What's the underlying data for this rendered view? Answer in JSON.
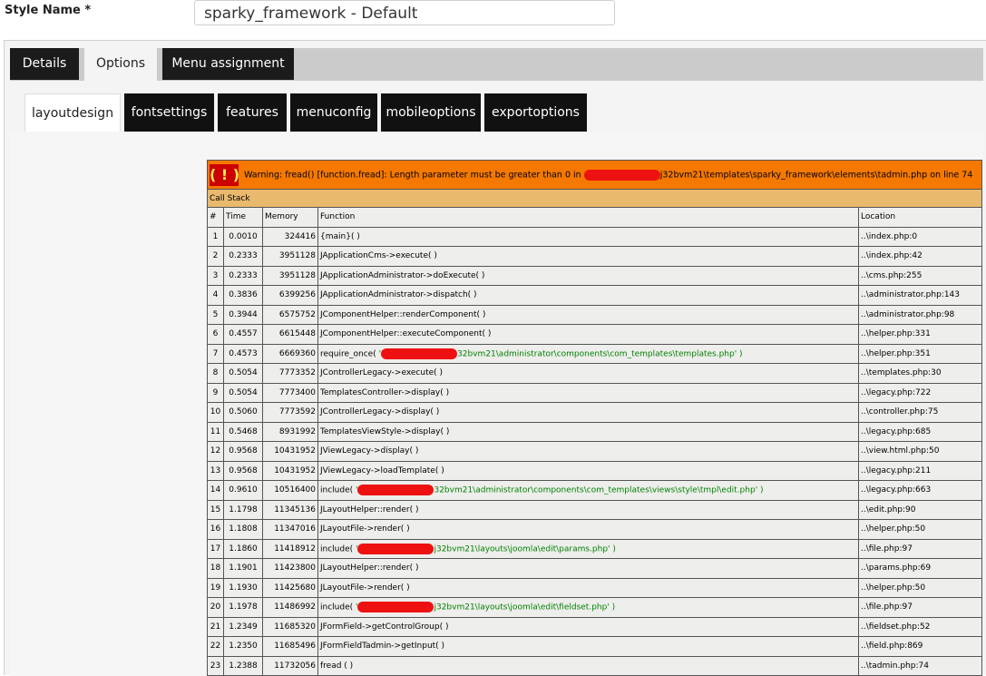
{
  "style_name": {
    "label": "Style Name *",
    "value": "sparky_framework - Default"
  },
  "tabs": [
    {
      "label": "Details",
      "active": false
    },
    {
      "label": "Options",
      "active": true
    },
    {
      "label": "Menu assignment",
      "active": false
    }
  ],
  "subtabs": [
    {
      "label": "layoutdesign",
      "active": true
    },
    {
      "label": "fontsettings",
      "active": false
    },
    {
      "label": "features",
      "active": false
    },
    {
      "label": "menuconfig",
      "active": false
    },
    {
      "label": "mobileoptions",
      "active": false
    },
    {
      "label": "exportoptions",
      "active": false
    }
  ],
  "warning": {
    "icon_text": "( ! )",
    "prefix": "Warning: fread() [function.fread]: Length parameter must be greater than 0 in",
    "suffix": "j32bvm21\\templates\\sparky_framework\\elements\\tadmin.php on line 74"
  },
  "call_stack_title": "Call Stack",
  "columns": [
    "#",
    "Time",
    "Memory",
    "Function",
    "Location"
  ],
  "rows": [
    {
      "n": "1",
      "time": "0.0010",
      "mem": "324416",
      "fn": "{main}( )",
      "param": "",
      "loc": "..\\index.php:0"
    },
    {
      "n": "2",
      "time": "0.2333",
      "mem": "3951128",
      "fn": "JApplicationCms->execute( )",
      "param": "",
      "loc": "..\\index.php:42"
    },
    {
      "n": "3",
      "time": "0.2333",
      "mem": "3951128",
      "fn": "JApplicationAdministrator->doExecute( )",
      "param": "",
      "loc": "..\\cms.php:255"
    },
    {
      "n": "4",
      "time": "0.3836",
      "mem": "6399256",
      "fn": "JApplicationAdministrator->dispatch( )",
      "param": "",
      "loc": "..\\administrator.php:143"
    },
    {
      "n": "5",
      "time": "0.3944",
      "mem": "6575752",
      "fn": "JComponentHelper::renderComponent( )",
      "param": "",
      "loc": "..\\administrator.php:98"
    },
    {
      "n": "6",
      "time": "0.4557",
      "mem": "6615448",
      "fn": "JComponentHelper::executeComponent( )",
      "param": "",
      "loc": "..\\helper.php:331"
    },
    {
      "n": "7",
      "time": "0.4573",
      "mem": "6669360",
      "fn": "require_once(",
      "param": "32bvm21\\administrator\\components\\com_templates\\templates.php' )",
      "loc": "..\\helper.php:351"
    },
    {
      "n": "8",
      "time": "0.5054",
      "mem": "7773352",
      "fn": "JControllerLegacy->execute( )",
      "param": "",
      "loc": "..\\templates.php:30"
    },
    {
      "n": "9",
      "time": "0.5054",
      "mem": "7773400",
      "fn": "TemplatesController->display( )",
      "param": "",
      "loc": "..\\legacy.php:722"
    },
    {
      "n": "10",
      "time": "0.5060",
      "mem": "7773592",
      "fn": "JControllerLegacy->display( )",
      "param": "",
      "loc": "..\\controller.php:75"
    },
    {
      "n": "11",
      "time": "0.5468",
      "mem": "8931992",
      "fn": "TemplatesViewStyle->display( )",
      "param": "",
      "loc": "..\\legacy.php:685"
    },
    {
      "n": "12",
      "time": "0.9568",
      "mem": "10431952",
      "fn": "JViewLegacy->display( )",
      "param": "",
      "loc": "..\\view.html.php:50"
    },
    {
      "n": "13",
      "time": "0.9568",
      "mem": "10431952",
      "fn": "JViewLegacy->loadTemplate( )",
      "param": "",
      "loc": "..\\legacy.php:211"
    },
    {
      "n": "14",
      "time": "0.9610",
      "mem": "10516400",
      "fn": "include(",
      "param": "32bvm21\\administrator\\components\\com_templates\\views\\style\\tmpl\\edit.php' )",
      "loc": "..\\legacy.php:663"
    },
    {
      "n": "15",
      "time": "1.1798",
      "mem": "11345136",
      "fn": "JLayoutHelper::render( )",
      "param": "",
      "loc": "..\\edit.php:90"
    },
    {
      "n": "16",
      "time": "1.1808",
      "mem": "11347016",
      "fn": "JLayoutFile->render( )",
      "param": "",
      "loc": "..\\helper.php:50"
    },
    {
      "n": "17",
      "time": "1.1860",
      "mem": "11418912",
      "fn": "include(",
      "param": "j32bvm21\\layouts\\joomla\\edit\\params.php' )",
      "loc": "..\\file.php:97"
    },
    {
      "n": "18",
      "time": "1.1901",
      "mem": "11423800",
      "fn": "JLayoutHelper::render( )",
      "param": "",
      "loc": "..\\params.php:69"
    },
    {
      "n": "19",
      "time": "1.1930",
      "mem": "11425680",
      "fn": "JLayoutFile->render( )",
      "param": "",
      "loc": "..\\helper.php:50"
    },
    {
      "n": "20",
      "time": "1.1978",
      "mem": "11486992",
      "fn": "include(",
      "param": "j32bvm21\\layouts\\joomla\\edit\\fieldset.php' )",
      "loc": "..\\file.php:97"
    },
    {
      "n": "21",
      "time": "1.2349",
      "mem": "11685320",
      "fn": "JFormField->getControlGroup( )",
      "param": "",
      "loc": "..\\fieldset.php:52"
    },
    {
      "n": "22",
      "time": "1.2350",
      "mem": "11685496",
      "fn": "JFormFieldTadmin->getInput( )",
      "param": "",
      "loc": "..\\field.php:869"
    },
    {
      "n": "23",
      "time": "1.2388",
      "mem": "11732056",
      "fn": "fread ( )",
      "param": "",
      "loc": "..\\tadmin.php:74"
    }
  ],
  "colors": {
    "warning": "#f57900",
    "callstack": "#e9b96e",
    "cell": "#eeeeec",
    "tab_dark": "#1b1b1b",
    "redaction": "#ee1111"
  }
}
